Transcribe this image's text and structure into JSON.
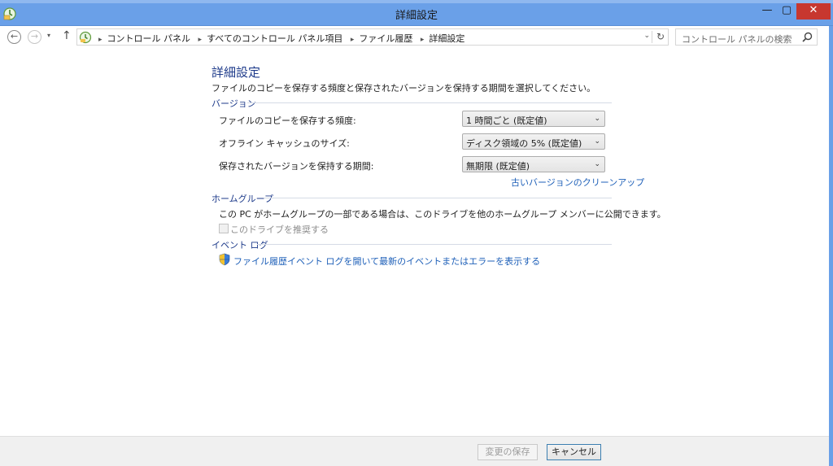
{
  "window": {
    "title": "詳細設定",
    "minimize": "—",
    "maximize": "▢",
    "close": "✕"
  },
  "nav": {
    "back_icon": "←",
    "forward_icon": "→",
    "recent_icon": "▾",
    "up_icon": "↑",
    "breadcrumbs": [
      "コントロール パネル",
      "すべてのコントロール パネル項目",
      "ファイル履歴",
      "詳細設定"
    ],
    "breadcrumb_sep": "▸",
    "dropdown_icon": "⌄",
    "refresh_icon": "↻",
    "search_placeholder": "コントロール パネルの検索"
  },
  "page": {
    "title": "詳細設定",
    "description": "ファイルのコピーを保存する頻度と保存されたバージョンを保持する期間を選択してください。"
  },
  "versions": {
    "heading": "バージョン",
    "rows": [
      {
        "label": "ファイルのコピーを保存する頻度:",
        "value": "1 時間ごと (既定値)"
      },
      {
        "label": "オフライン キャッシュのサイズ:",
        "value": "ディスク領域の 5% (既定値)"
      },
      {
        "label": "保存されたバージョンを保持する期間:",
        "value": "無期限 (既定値)"
      }
    ],
    "cleanup_link": "古いバージョンのクリーンアップ",
    "arrow": "⌄"
  },
  "homegroup": {
    "heading": "ホームグループ",
    "text": "この PC がホームグループの一部である場合は、このドライブを他のホームグループ メンバーに公開できます。",
    "checkbox_label": "このドライブを推奨する"
  },
  "eventlog": {
    "heading": "イベント ログ",
    "link": "ファイル履歴イベント ログを開いて最新のイベントまたはエラーを表示する"
  },
  "footer": {
    "save_label": "変更の保存",
    "cancel_label": "キャンセル"
  },
  "colors": {
    "titlebar": "#6aa0e8",
    "heading": "#1d3a8a",
    "link": "#1d5fb8",
    "close": "#c7372f"
  }
}
